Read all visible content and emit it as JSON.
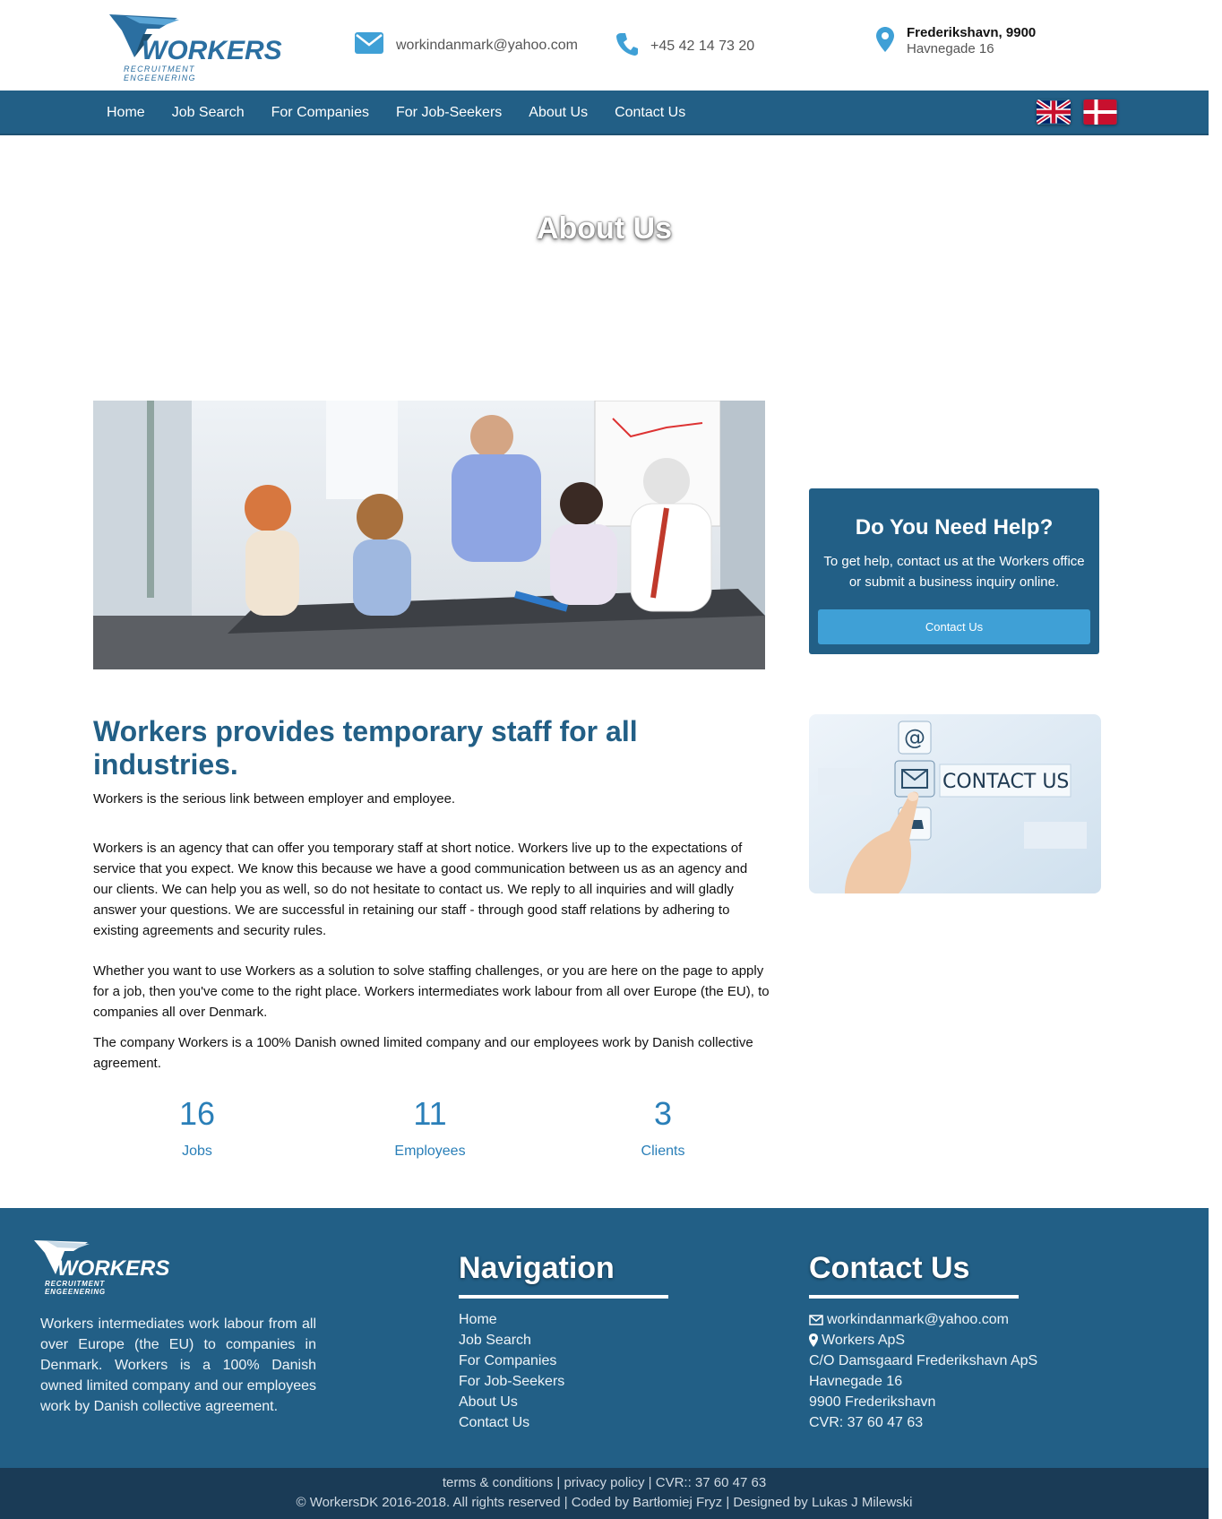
{
  "header": {
    "logo_word": "WORKERS",
    "logo_sub": "RECRUITMENT ENGEENERING",
    "email": "workindanmark@yahoo.com",
    "phone": "+45 42 14 73 20",
    "address_line1": "Frederikshavn, 9900",
    "address_line2": "Havnegade 16"
  },
  "nav": {
    "items": [
      {
        "label": "Home"
      },
      {
        "label": "Job Search"
      },
      {
        "label": "For Companies"
      },
      {
        "label": "For Job-Seekers"
      },
      {
        "label": "About Us"
      },
      {
        "label": "Contact Us"
      }
    ],
    "flags": [
      "uk-flag-icon",
      "denmark-flag-icon"
    ]
  },
  "hero": {
    "title": "About Us"
  },
  "main": {
    "headline": "Workers provides temporary staff for all industries.",
    "paragraphs": [
      "Workers is the serious link between employer and employee.",
      "Workers is an agency that can offer you temporary staff at short notice. Workers live up to the expectations of service that you expect. We know this because we have a good communication between us as an agency and our clients. We can help you as well, so do not hesitate to contact us. We reply to all inquiries and will gladly answer your questions. We are successful in retaining our staff - through good staff relations by adhering to existing agreements and security rules.",
      "Whether you want to use Workers as a solution to solve staffing challenges, or you are here on the page to apply for a job, then you've come to the right place. Workers intermediates work labour from all over Europe (the EU), to companies all over Denmark.",
      "The company Workers is a 100% Danish owned limited company and our employees work by Danish collective agreement."
    ],
    "stats": [
      {
        "value": "16",
        "label": "Jobs"
      },
      {
        "value": "11",
        "label": "Employees"
      },
      {
        "value": "3",
        "label": "Clients"
      }
    ]
  },
  "sidebar": {
    "help_title": "Do You Need Help?",
    "help_text": "To get help, contact us at the Workers office or submit a business inquiry online.",
    "help_button": "Contact Us",
    "banner_text": "CONTACT US"
  },
  "footer": {
    "logo_word": "WORKERS",
    "logo_sub": "RECRUITMENT ENGEENERING",
    "about": "Workers intermediates work labour from all over Europe (the EU) to companies in Denmark. Workers is a 100% Danish owned limited company and our employees work by Danish collective agreement.",
    "nav_heading": "Navigation",
    "nav_links": [
      "Home",
      "Job Search",
      "For Companies",
      "For Job-Seekers",
      "About Us",
      "Contact Us"
    ],
    "contact_heading": "Contact Us",
    "contact_email": "workindanmark@yahoo.com",
    "contact_company": "Workers ApS",
    "contact_lines": [
      "C/O Damsgaard Frederikshavn ApS",
      "Havnegade 16",
      "9900 Frederikshavn",
      "CVR: 37 60 47 63"
    ]
  },
  "bottom": {
    "terms": "terms & conditions",
    "privacy": "privacy policy",
    "cvr": "CVR:: 37 60 47 63",
    "copyright": "© WorkersDK 2016-2018. All rights reserved | Coded by Bartłomiej Fryz | Designed by Lukas J Milewski"
  },
  "colors": {
    "brand_blue": "#225f86",
    "accent_blue": "#3fa0d6",
    "stat_blue": "#2a7fb8",
    "footer_bottom": "#1a3b56"
  }
}
